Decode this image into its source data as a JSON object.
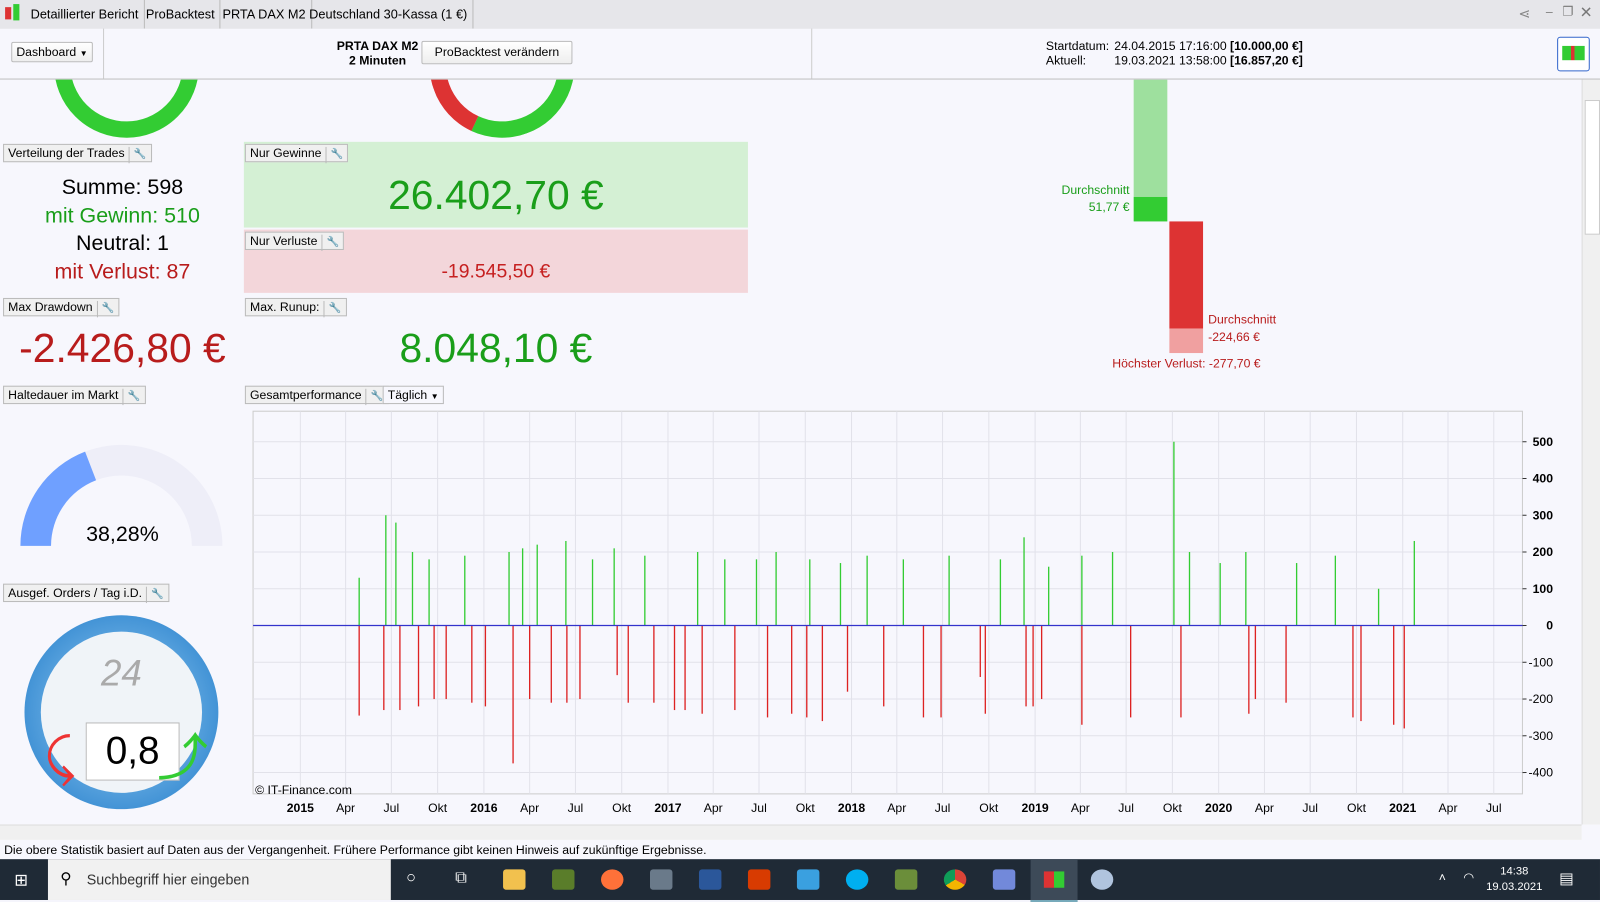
{
  "titlebar": {
    "tabs": [
      "Detaillierter Bericht",
      "ProBacktest",
      "PRTA DAX M2",
      "Deutschland 30-Kassa (1 €)"
    ]
  },
  "header": {
    "dashboard": "Dashboard",
    "strategy_name": "PRTA DAX M2",
    "timeframe": "2 Minuten",
    "change_button": "ProBacktest verändern",
    "start_label": "Startdatum:",
    "start_date": "24.04.2015 17:16:00",
    "start_capital": "[10.000,00 €]",
    "current_label": "Aktuell:",
    "current_date": "19.03.2021 13:58:00",
    "current_capital": "[16.857,20 €]"
  },
  "trades": {
    "label": "Verteilung der Trades",
    "sum": "Summe: 598",
    "win": "mit Gewinn: 510",
    "neutral": "Neutral: 1",
    "loss": "mit Verlust: 87"
  },
  "gains": {
    "label": "Nur Gewinne",
    "value": "26.402,70 €"
  },
  "losses": {
    "label": "Nur Verluste",
    "value": "-19.545,50 €"
  },
  "drawdown": {
    "label": "Max Drawdown",
    "value": "-2.426,80 €"
  },
  "runup": {
    "label": "Max. Runup:",
    "value": "8.048,10 €"
  },
  "holding": {
    "label": "Haltedauer im Markt",
    "value": "38,28%",
    "fraction": 0.3828
  },
  "orders": {
    "label": "Ausgef. Orders / Tag i.D.",
    "value": "0,8",
    "dial": "24"
  },
  "avg": {
    "win_label": "Durchschnitt",
    "win_value": "51,77 €",
    "loss_label": "Durchschnitt",
    "loss_value": "-224,66 €",
    "max_loss": "Höchster Verlust: -277,70 €"
  },
  "perf": {
    "label": "Gesamtperformance",
    "period": "Täglich",
    "copyright": "© IT-Finance.com"
  },
  "chart_data": {
    "type": "bar",
    "ylim": [
      -458,
      583
    ],
    "xlim": [
      "2014-09-29",
      "2021-08-27"
    ],
    "grid": true,
    "yticks": [
      500,
      400,
      300,
      200,
      100,
      0,
      -100,
      -200,
      -300,
      -400
    ],
    "xticks": [
      {
        "d": "2015-01-01",
        "l": "2015",
        "b": true
      },
      {
        "d": "2015-04-01",
        "l": "Apr"
      },
      {
        "d": "2015-07-01",
        "l": "Jul"
      },
      {
        "d": "2015-10-01",
        "l": "Okt"
      },
      {
        "d": "2016-01-01",
        "l": "2016",
        "b": true
      },
      {
        "d": "2016-04-01",
        "l": "Apr"
      },
      {
        "d": "2016-07-01",
        "l": "Jul"
      },
      {
        "d": "2016-10-01",
        "l": "Okt"
      },
      {
        "d": "2017-01-01",
        "l": "2017",
        "b": true
      },
      {
        "d": "2017-04-01",
        "l": "Apr"
      },
      {
        "d": "2017-07-01",
        "l": "Jul"
      },
      {
        "d": "2017-10-01",
        "l": "Okt"
      },
      {
        "d": "2018-01-01",
        "l": "2018",
        "b": true
      },
      {
        "d": "2018-04-01",
        "l": "Apr"
      },
      {
        "d": "2018-07-01",
        "l": "Jul"
      },
      {
        "d": "2018-10-01",
        "l": "Okt"
      },
      {
        "d": "2019-01-01",
        "l": "2019",
        "b": true
      },
      {
        "d": "2019-04-01",
        "l": "Apr"
      },
      {
        "d": "2019-07-01",
        "l": "Jul"
      },
      {
        "d": "2019-10-01",
        "l": "Okt"
      },
      {
        "d": "2020-01-01",
        "l": "2020",
        "b": true
      },
      {
        "d": "2020-04-01",
        "l": "Apr"
      },
      {
        "d": "2020-07-01",
        "l": "Jul"
      },
      {
        "d": "2020-10-01",
        "l": "Okt"
      },
      {
        "d": "2021-01-01",
        "l": "2021",
        "b": true
      },
      {
        "d": "2021-04-01",
        "l": "Apr"
      },
      {
        "d": "2021-07-01",
        "l": "Jul"
      }
    ],
    "bars": [
      [
        "2015-04-28",
        130
      ],
      [
        "2015-06-20",
        300
      ],
      [
        "2015-07-10",
        280
      ],
      [
        "2015-08-12",
        200
      ],
      [
        "2015-09-14",
        180
      ],
      [
        "2015-11-24",
        190
      ],
      [
        "2016-02-20",
        200
      ],
      [
        "2016-03-18",
        210
      ],
      [
        "2016-04-16",
        220
      ],
      [
        "2016-06-12",
        230
      ],
      [
        "2016-08-04",
        180
      ],
      [
        "2016-09-16",
        210
      ],
      [
        "2016-11-16",
        190
      ],
      [
        "2017-03-01",
        200
      ],
      [
        "2017-04-24",
        180
      ],
      [
        "2017-06-26",
        180
      ],
      [
        "2017-08-04",
        200
      ],
      [
        "2017-10-10",
        180
      ],
      [
        "2017-12-10",
        170
      ],
      [
        "2018-02-01",
        190
      ],
      [
        "2018-04-14",
        180
      ],
      [
        "2018-07-14",
        190
      ],
      [
        "2018-10-24",
        180
      ],
      [
        "2018-12-10",
        240
      ],
      [
        "2019-01-28",
        160
      ],
      [
        "2019-04-04",
        190
      ],
      [
        "2019-06-04",
        200
      ],
      [
        "2019-10-04",
        500
      ],
      [
        "2019-11-04",
        200
      ],
      [
        "2020-01-04",
        170
      ],
      [
        "2020-02-24",
        200
      ],
      [
        "2020-06-04",
        170
      ],
      [
        "2020-08-20",
        190
      ],
      [
        "2020-11-14",
        100
      ],
      [
        "2021-01-24",
        230
      ],
      [
        "2015-04-28",
        -245
      ],
      [
        "2015-06-16",
        -230
      ],
      [
        "2015-07-18",
        -230
      ],
      [
        "2015-08-24",
        -220
      ],
      [
        "2015-09-24",
        -200
      ],
      [
        "2015-10-18",
        -200
      ],
      [
        "2015-12-08",
        -210
      ],
      [
        "2016-01-04",
        -220
      ],
      [
        "2016-02-28",
        -375
      ],
      [
        "2016-04-01",
        -200
      ],
      [
        "2016-05-14",
        -210
      ],
      [
        "2016-06-14",
        -210
      ],
      [
        "2016-07-10",
        -200
      ],
      [
        "2016-09-22",
        -135
      ],
      [
        "2016-10-14",
        -210
      ],
      [
        "2016-12-04",
        -210
      ],
      [
        "2017-01-14",
        -230
      ],
      [
        "2017-02-04",
        -230
      ],
      [
        "2017-03-10",
        -240
      ],
      [
        "2017-05-14",
        -230
      ],
      [
        "2017-07-18",
        -250
      ],
      [
        "2017-09-04",
        -240
      ],
      [
        "2017-10-04",
        -250
      ],
      [
        "2017-11-04",
        -260
      ],
      [
        "2017-12-24",
        -180
      ],
      [
        "2018-03-06",
        -220
      ],
      [
        "2018-05-24",
        -250
      ],
      [
        "2018-06-28",
        -250
      ],
      [
        "2018-09-14",
        -140
      ],
      [
        "2018-09-24",
        -240
      ],
      [
        "2018-12-14",
        -220
      ],
      [
        "2018-12-28",
        -220
      ],
      [
        "2019-01-14",
        -200
      ],
      [
        "2019-04-04",
        -270
      ],
      [
        "2019-07-10",
        -250
      ],
      [
        "2019-10-18",
        -250
      ],
      [
        "2020-03-01",
        -240
      ],
      [
        "2020-03-14",
        -200
      ],
      [
        "2020-05-14",
        -210
      ],
      [
        "2020-09-24",
        -250
      ],
      [
        "2020-10-10",
        -260
      ],
      [
        "2020-12-14",
        -270
      ],
      [
        "2021-01-04",
        -280
      ]
    ],
    "colors": {
      "gain": "#33cc33",
      "loss": "#dd2222",
      "zero": "#3333cc"
    }
  },
  "footer": {
    "disclaimer": "Die obere Statistik basiert auf Daten aus der Vergangenheit. Frühere Performance gibt keinen Hinweis auf zukünftige Ergebnisse."
  },
  "taskbar": {
    "search": "Suchbegriff hier eingeben",
    "time": "14:38",
    "date": "19.03.2021"
  }
}
